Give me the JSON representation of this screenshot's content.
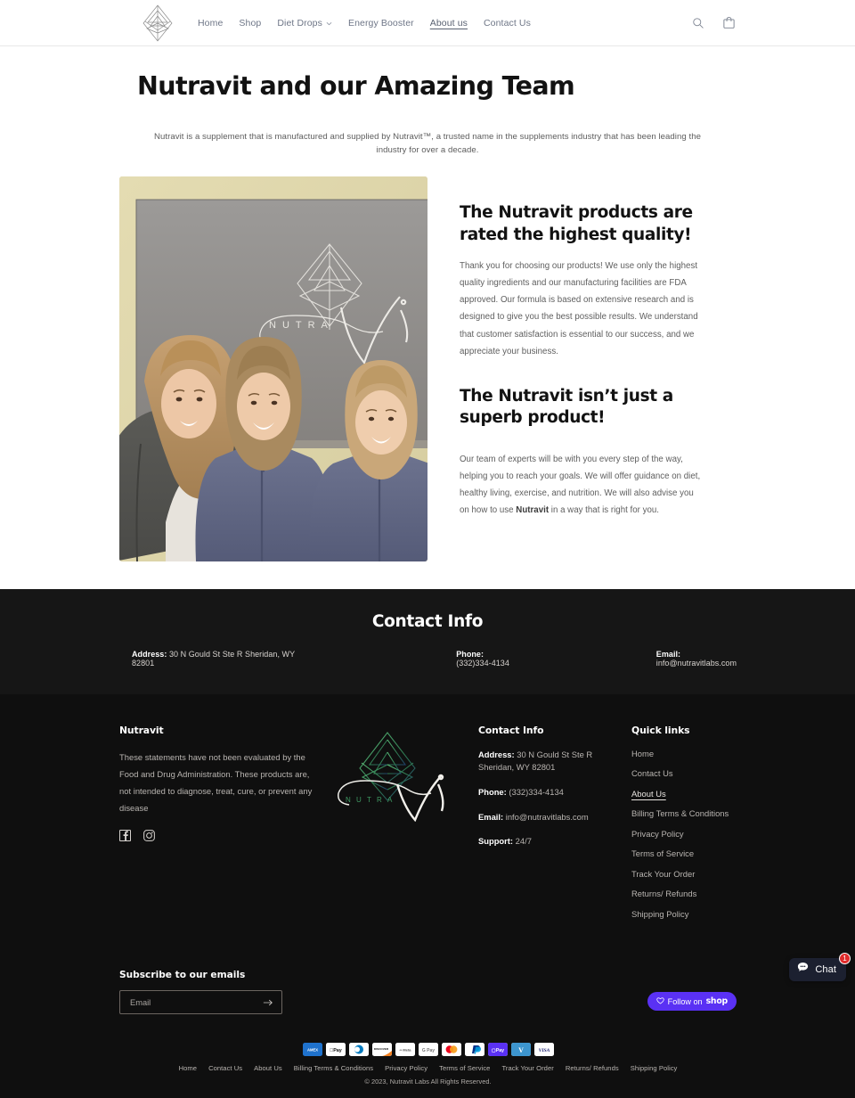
{
  "header": {
    "logo_alt": "Nutravit geometric leaf logo",
    "nav": [
      {
        "label": "Home",
        "active": false,
        "has_dropdown": false
      },
      {
        "label": "Shop",
        "active": false,
        "has_dropdown": false
      },
      {
        "label": "Diet Drops",
        "active": false,
        "has_dropdown": true
      },
      {
        "label": "Energy Booster",
        "active": false,
        "has_dropdown": false
      },
      {
        "label": "About us",
        "active": true,
        "has_dropdown": false
      },
      {
        "label": "Contact Us",
        "active": false,
        "has_dropdown": false
      }
    ],
    "search_icon": "search-icon",
    "cart_icon": "shopping-bag-icon"
  },
  "main": {
    "page_title": "Nutravit and our Amazing Team",
    "intro": "Nutravit is a supplement that is manufactured and supplied by Nutravit™, a trusted name in the supplements industry that has been leading the industry for over a decade.",
    "image_caption": "Three team members standing in front of a Nutravit branded banner",
    "banner_text": "NUTRA Vit",
    "blocks": [
      {
        "heading": "The Nutravit products are rated the highest quality!",
        "body": "Thank you for choosing our products! We use only the highest quality ingredients and our manufacturing facilities are FDA approved. Our formula is based on extensive research and is designed to give you the best possible results. We understand that customer satisfaction is essential to our success, and we appreciate your business."
      },
      {
        "heading": "The Nutravit isn’t just a superb product!",
        "body_pre": "Our team of experts will be with you every step of the way, helping you to reach your goals. We will offer guidance on diet, healthy living, exercise, and nutrition. We will also advise you on how to use ",
        "body_bold": "Nutravit",
        "body_post": " in a way that is right for you."
      }
    ]
  },
  "contact_band": {
    "title": "Contact Info",
    "address_label": "Address:",
    "address_value": " 30 N Gould St Ste R Sheridan, WY 82801",
    "phone_label": "Phone:",
    "phone_value": " (332)334-4134",
    "email_label": "Email:",
    "email_value": " info@nutravitlabs.com"
  },
  "footer": {
    "brand": {
      "heading": "Nutravit",
      "disclaimer": "These statements have not been evaluated by the Food and Drug Administration. These products are, not intended to diagnose, treat, cure, or prevent any disease",
      "socials": [
        {
          "name": "facebook-icon",
          "label": "Facebook"
        },
        {
          "name": "instagram-icon",
          "label": "Instagram"
        }
      ]
    },
    "logo": {
      "word_mark": "NUTRA",
      "script_mark": "Vit"
    },
    "contact": {
      "heading": "Contact Info",
      "rows": [
        {
          "label": "Address:",
          "value": " 30 N Gould St Ste R Sheridan, WY 82801"
        },
        {
          "label": "Phone:",
          "value": " (332)334-4134"
        },
        {
          "label": "Email:",
          "value": " info@nutravitlabs.com"
        },
        {
          "label": "Support:",
          "value": " 24/7"
        }
      ]
    },
    "quick_links": {
      "heading": "Quick links",
      "items": [
        {
          "label": "Home",
          "active": false
        },
        {
          "label": "Contact Us",
          "active": false
        },
        {
          "label": "About Us",
          "active": true
        },
        {
          "label": "Billing Terms & Conditions",
          "active": false
        },
        {
          "label": "Privacy Policy",
          "active": false
        },
        {
          "label": "Terms of Service",
          "active": false
        },
        {
          "label": "Track Your Order",
          "active": false
        },
        {
          "label": "Returns/ Refunds",
          "active": false
        },
        {
          "label": "Shipping Policy",
          "active": false
        }
      ]
    },
    "subscribe": {
      "heading": "Subscribe to our emails",
      "placeholder": "Email",
      "value": "",
      "submit_icon": "arrow-right-icon"
    },
    "follow": {
      "prefix": "Follow on",
      "brand": "shop",
      "heart_icon": "heart-icon",
      "color": "#5A31F4"
    },
    "payments": [
      {
        "name": "amex",
        "label": "AMEX"
      },
      {
        "name": "apple-pay",
        "label": "Pay"
      },
      {
        "name": "diners-club",
        "label": "DC"
      },
      {
        "name": "discover",
        "label": "DISCOVER"
      },
      {
        "name": "meta-pay",
        "label": "Meta"
      },
      {
        "name": "google-pay",
        "label": "G Pay"
      },
      {
        "name": "mastercard",
        "label": "MC"
      },
      {
        "name": "paypal",
        "label": "PayPal"
      },
      {
        "name": "shop-pay",
        "label": "Pay"
      },
      {
        "name": "venmo",
        "label": "V"
      },
      {
        "name": "visa",
        "label": "VISA"
      }
    ],
    "policy_links": [
      "Home",
      "Contact Us",
      "About Us",
      "Billing Terms & Conditions",
      "Privacy Policy",
      "Terms of Service",
      "Track Your Order",
      "Returns/ Refunds",
      "Shipping Policy"
    ],
    "copyright": "© 2023, Nutravit Labs All Rights Reserved."
  },
  "chat_widget": {
    "label": "Chat",
    "badge": "1",
    "icon": "chat-bubble-icon"
  }
}
